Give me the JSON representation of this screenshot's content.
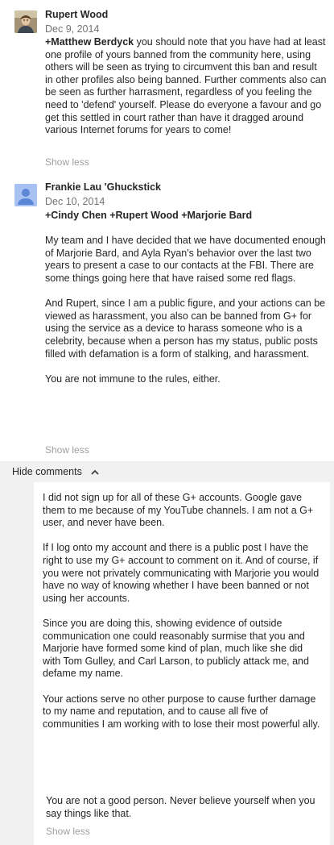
{
  "comments": [
    {
      "author": "Rupert Wood",
      "date": "Dec 9, 2014",
      "mention": "+Matthew Berdyck",
      "text": " you should note that you have had at least one profile of yours banned from the community here, using others will be seen as trying to circumvent this ban and result in other profiles also being banned. Further comments also can be seen as further harrasment, regardless of you feeling the need to 'defend' yourself. Please do everyone a favour and go get this settled in court rather than have it dragged around various Internet forums for years to come!",
      "show_less": "Show less"
    },
    {
      "author": "Frankie Lau 'Ghuckstick",
      "date": "Dec 10, 2014",
      "mentions": "+Cindy Chen +Rupert Wood +Marjorie Bard",
      "paragraphs": [
        "My team and I have decided that we have documented enough of Marjorie Bard, and Ayla Ryan's behavior over the last two years to present a case to our contacts at the FBI.  There are some things going here that have raised some red flags.",
        "And Rupert, since I am a public figure, and your actions can be viewed as harassment, you also can be banned from G+ for using the service as a device to harass someone who is a celebrity, because when a person has my status, public posts filled with defamation is a form of stalking, and harassment.",
        "You are not immune to the rules, either."
      ],
      "show_less": "Show less"
    }
  ],
  "hide_comments": "Hide comments",
  "reply": {
    "paragraphs": [
      "I did not sign up for all of these G+ accounts.  Google gave them to me because of my YouTube channels.  I am not a G+ user, and never have been.",
      "If I log onto my account and there is a public post I have the right to use my G+ account to comment on it.  And of course, if you were not privately communicating with Marjorie you would have no way of knowing whether I have been banned or not using her accounts.",
      "Since you are doing this, showing evidence of outside communication one could reasonably surmise that you and Marjorie have formed some kind of plan, much like she did with Tom Gulley, and Carl Larson, to publicly attack me, and defame my name.",
      "Your actions serve no other purpose to cause further damage to my name and reputation, and to cause all five of communities I am working with to lose their most powerful ally."
    ],
    "last_paragraph": "You are not a good person.  Never believe yourself when you say things like that.",
    "show_less": "Show less"
  }
}
